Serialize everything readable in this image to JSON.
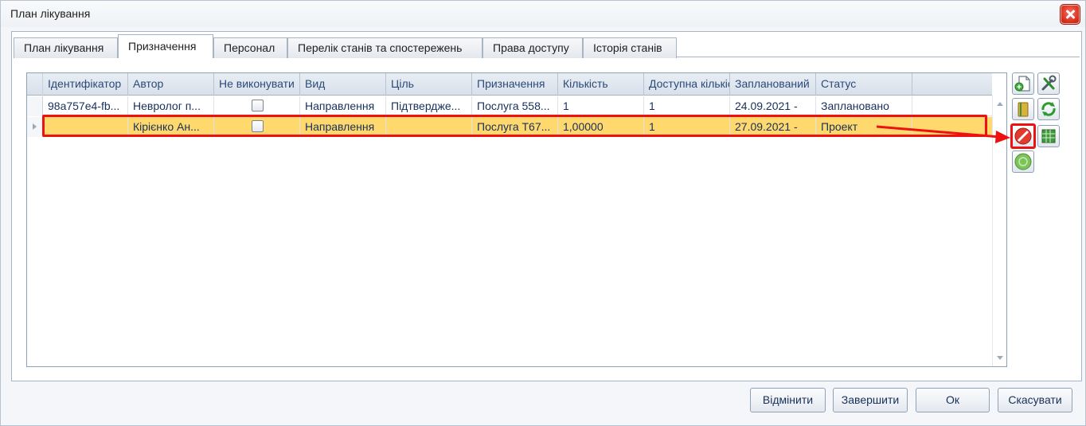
{
  "window": {
    "title": "План лікування"
  },
  "tabs": [
    {
      "label": "План лікування",
      "active": false
    },
    {
      "label": "Призначення",
      "active": true
    },
    {
      "label": "Персонал",
      "active": false
    },
    {
      "label": "Перелік станів та спостережень",
      "active": false
    },
    {
      "label": "Права доступу",
      "active": false
    },
    {
      "label": "Історія станів",
      "active": false
    }
  ],
  "grid": {
    "columns": [
      "Ідентифікатор",
      "Автор",
      "Не виконувати",
      "Вид",
      "Ціль",
      "Призначення",
      "Кількість",
      "Доступна кількість",
      "Запланований",
      "Статус"
    ],
    "rows": [
      {
        "id": "98a757e4-fb...",
        "author": "Невролог п...",
        "skip": false,
        "kind": "Направлення",
        "goal": "Підтвердже...",
        "purpose": "Послуга 558...",
        "qty": "1",
        "available": "1",
        "planned": "24.09.2021 -",
        "status": "Заплановано",
        "selected": false
      },
      {
        "id": "",
        "author": "Кірієнко Ан...",
        "skip": false,
        "kind": "Направлення",
        "goal": "",
        "purpose": "Послуга Т67...",
        "qty": "1,00000",
        "available": "1",
        "planned": "27.09.2021 -",
        "status": "Проект",
        "selected": true
      }
    ]
  },
  "toolbar": [
    {
      "name": "add-document-icon"
    },
    {
      "name": "tools-icon"
    },
    {
      "name": "book-icon"
    },
    {
      "name": "refresh-link-icon"
    },
    {
      "name": "cancel-icon"
    },
    {
      "name": "table-icon"
    },
    {
      "name": "green-circle-icon"
    }
  ],
  "buttons": {
    "undo": "Відмінити",
    "finish": "Завершити",
    "ok": "Ок",
    "cancel": "Скасувати"
  },
  "colors": {
    "selected_row": "#ffd96e",
    "highlight": "#ee1111",
    "header_text": "#2a4a78"
  }
}
